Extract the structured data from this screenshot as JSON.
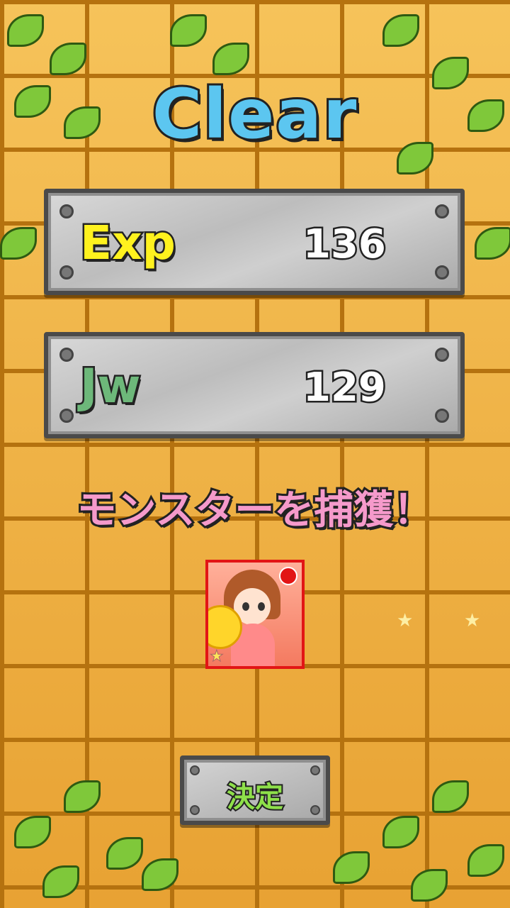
{
  "screen": {
    "title": "Clear"
  },
  "results": {
    "exp": {
      "label": "Exp",
      "value": "136"
    },
    "jewel": {
      "label": "Jw",
      "value": "129"
    }
  },
  "capture": {
    "message": "モンスターを捕獲！",
    "monster_card": {
      "element_icon": "fire-element-icon",
      "rarity_icon": "star-icon",
      "border_color": "#e21515"
    }
  },
  "actions": {
    "confirm_label": "決定"
  },
  "colors": {
    "title": "#5cc6f0",
    "exp_label": "#fff21e",
    "jw_label": "#6db87a",
    "capture_message": "#f59acb",
    "confirm_label": "#8ee04a"
  }
}
